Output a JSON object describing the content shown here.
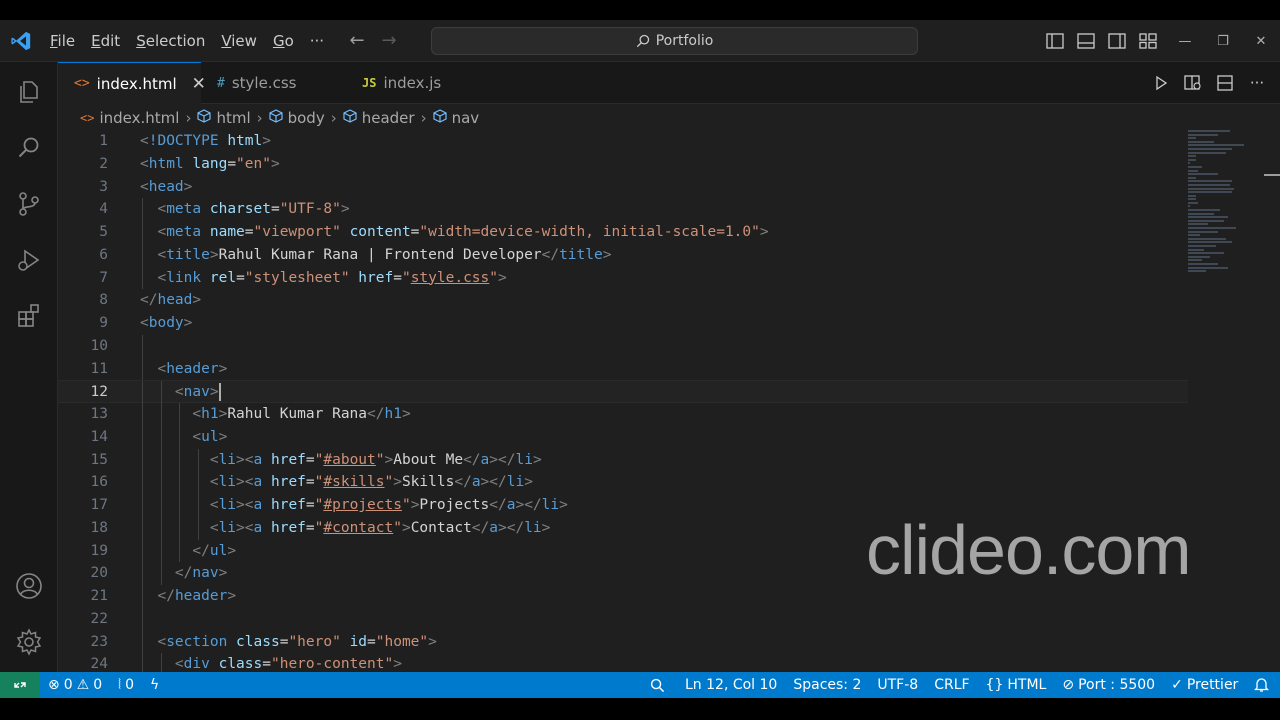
{
  "titlebar": {
    "menus": [
      {
        "label": "File",
        "u": "F",
        "rest": "ile"
      },
      {
        "label": "Edit",
        "u": "E",
        "rest": "dit"
      },
      {
        "label": "Selection",
        "u": "S",
        "rest": "election"
      },
      {
        "label": "View",
        "u": "V",
        "rest": "iew"
      },
      {
        "label": "Go",
        "u": "G",
        "rest": "o"
      }
    ],
    "more": "···",
    "command_center": "Portfolio"
  },
  "tabs": [
    {
      "label": "index.html",
      "icon": "<>",
      "icon_color": "#e37933",
      "active": true,
      "close": "✕"
    },
    {
      "label": "style.css",
      "icon": "#",
      "icon_color": "#519aba",
      "active": false
    },
    {
      "label": "index.js",
      "icon": "JS",
      "icon_color": "#cbcb41",
      "active": false
    }
  ],
  "breadcrumb": [
    "index.html",
    "html",
    "body",
    "header",
    "nav"
  ],
  "editor": {
    "current_line": 12,
    "lines": [
      {
        "n": "1",
        "indent": 0
      },
      {
        "n": "2",
        "indent": 0
      },
      {
        "n": "3",
        "indent": 0
      },
      {
        "n": "4",
        "indent": 1
      },
      {
        "n": "5",
        "indent": 1
      },
      {
        "n": "6",
        "indent": 1
      },
      {
        "n": "7",
        "indent": 1
      },
      {
        "n": "8",
        "indent": 0
      },
      {
        "n": "9",
        "indent": 0
      },
      {
        "n": "10",
        "indent": 1
      },
      {
        "n": "11",
        "indent": 1
      },
      {
        "n": "12",
        "indent": 2
      },
      {
        "n": "13",
        "indent": 3
      },
      {
        "n": "14",
        "indent": 3
      },
      {
        "n": "15",
        "indent": 4
      },
      {
        "n": "16",
        "indent": 4
      },
      {
        "n": "17",
        "indent": 4
      },
      {
        "n": "18",
        "indent": 4
      },
      {
        "n": "19",
        "indent": 3
      },
      {
        "n": "20",
        "indent": 2
      },
      {
        "n": "21",
        "indent": 1
      },
      {
        "n": "22",
        "indent": 1
      },
      {
        "n": "23",
        "indent": 1
      },
      {
        "n": "24",
        "indent": 2
      }
    ],
    "code": {
      "doctype": "!DOCTYPE",
      "html_kw": "html",
      "html_tag": "html",
      "lang_attr": "lang",
      "lang_val": "\"en\"",
      "head": "head",
      "meta": "meta",
      "charset_attr": "charset",
      "charset_val": "\"UTF-8\"",
      "name_attr": "name",
      "name_val": "\"viewport\"",
      "content_attr": "content",
      "content_val": "\"width=device-width, initial-scale=1.0\"",
      "title_tag": "title",
      "title_text": "Rahul Kumar Rana | Frontend Developer",
      "link": "link",
      "rel_attr": "rel",
      "rel_val": "\"stylesheet\"",
      "href_attr": "href",
      "href_css": "style.css",
      "body": "body",
      "header": "header",
      "nav": "nav",
      "h1": "h1",
      "h1_text": "Rahul Kumar Rana",
      "ul": "ul",
      "li": "li",
      "a": "a",
      "about_href": "#about",
      "about_text": "About Me",
      "skills_href": "#skills",
      "skills_text": "Skills",
      "projects_href": "#projects",
      "projects_text": "Projects",
      "contact_href": "#contact",
      "contact_text": "Contact",
      "section": "section",
      "class_attr": "class",
      "hero_val": "\"hero\"",
      "id_attr": "id",
      "home_val": "\"home\"",
      "div": "div",
      "hero_content_val": "\"hero-content\""
    }
  },
  "watermark": "clideo.com",
  "statusbar": {
    "errors": "0",
    "warnings": "0",
    "ports": "0",
    "position": "Ln 12, Col 10",
    "spaces": "Spaces: 2",
    "encoding": "UTF-8",
    "eol": "CRLF",
    "language": "HTML",
    "live_server": "Port : 5500",
    "prettier": "Prettier"
  },
  "colors": {
    "accent": "#007acc",
    "remote": "#16825d",
    "tag": "#569cd6",
    "attribute": "#9cdcfe",
    "string": "#ce9178"
  }
}
